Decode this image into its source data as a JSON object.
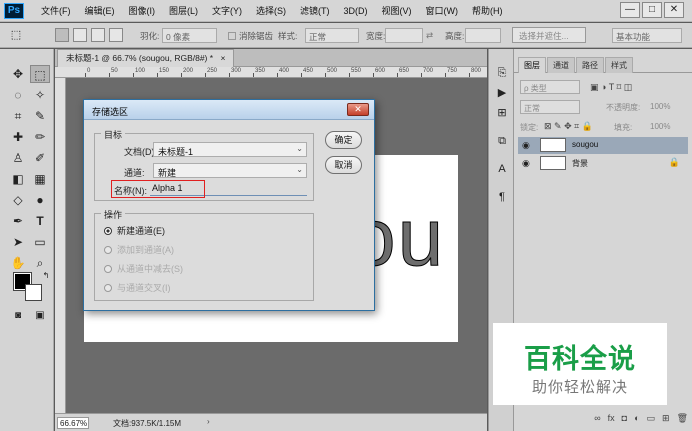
{
  "app": {
    "logo": "Ps",
    "menus": [
      "文件(F)",
      "编辑(E)",
      "图像(I)",
      "图层(L)",
      "文字(Y)",
      "选择(S)",
      "滤镜(T)",
      "3D(D)",
      "视图(V)",
      "窗口(W)",
      "帮助(H)"
    ],
    "window_controls": {
      "minimize": "—",
      "restore": "□",
      "close": "✕"
    }
  },
  "options_bar": {
    "feather_label": "羽化:",
    "feather_value": "0 像素",
    "antialias_label": "消除锯齿",
    "style_label": "样式:",
    "style_value": "正常",
    "width_label": "宽度:",
    "height_label": "高度:",
    "select_mask_button": "选择并遮住...",
    "workspace_value": "基本功能"
  },
  "document": {
    "tab_title": "未标题-1 @ 66.7% (sougou, RGB/8#) *",
    "tab_close": "×",
    "canvas_text": "ou",
    "ruler_marks": [
      "0",
      "50",
      "100",
      "150",
      "200",
      "250",
      "300",
      "350",
      "400",
      "450",
      "500",
      "550",
      "600",
      "650",
      "700",
      "750",
      "800",
      "850"
    ]
  },
  "status_bar": {
    "zoom": "66.67%",
    "doc_info": "文档:937.5K/1.15M",
    "arrow": "›"
  },
  "layers_panel": {
    "tabs": [
      "图层",
      "通道",
      "路径",
      "样式"
    ],
    "kind_filter": "ρ 类型",
    "blend_mode": "正常",
    "opacity_label": "不透明度:",
    "opacity_value": "100%",
    "lock_label": "锁定:",
    "fill_label": "填充:",
    "fill_value": "100%",
    "layers": [
      {
        "name": "sougou",
        "selected": true
      },
      {
        "name": "背景",
        "locked": true
      }
    ],
    "bottom_icons": [
      "link-icon",
      "fx-icon",
      "mask-icon",
      "adjustment-icon",
      "folder-icon",
      "new-layer-icon",
      "trash-icon"
    ]
  },
  "dialog": {
    "title": "存储选区",
    "close": "✕",
    "target_group": "目标",
    "document_label": "文档(D):",
    "document_value": "未标题-1",
    "channel_label": "通道:",
    "channel_value": "新建",
    "name_label": "名称(N):",
    "name_value": "Alpha 1",
    "ok_button": "确定",
    "cancel_button": "取消",
    "operation_group": "操作",
    "operations": [
      {
        "label": "新建通道(E)",
        "checked": true,
        "enabled": true
      },
      {
        "label": "添加到通道(A)",
        "checked": false,
        "enabled": false
      },
      {
        "label": "从通道中减去(S)",
        "checked": false,
        "enabled": false
      },
      {
        "label": "与通道交叉(I)",
        "checked": false,
        "enabled": false
      }
    ]
  },
  "watermark": {
    "title": "百科全说",
    "subtitle": "助你轻松解决"
  },
  "colors": {
    "foreground": "#000000",
    "background": "#ffffff",
    "watermark_green": "#1a9e48",
    "highlight_red": "#e02020"
  }
}
